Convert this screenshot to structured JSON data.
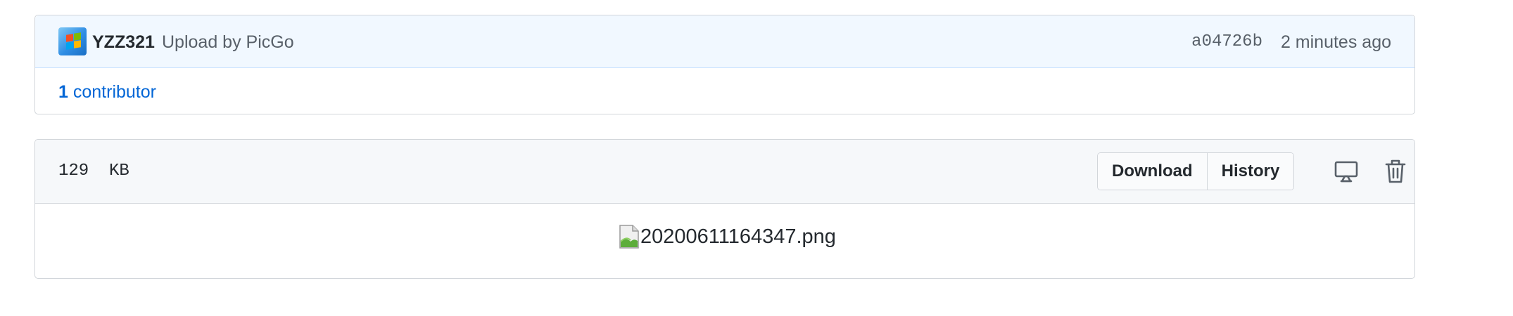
{
  "commit": {
    "author": "YZZ321",
    "message": "Upload by PicGo",
    "sha": "a04726b",
    "time": "2 minutes ago",
    "contributor_count": "1",
    "contributor_label": "contributor"
  },
  "file": {
    "size": "129  KB",
    "buttons": {
      "download": "Download",
      "history": "History"
    },
    "icons": {
      "display": "desktop-display-icon",
      "delete": "trash-icon"
    },
    "image_alt": "20200611164347.png"
  },
  "colors": {
    "link": "#0366d6",
    "commit_header_bg": "#f1f8ff",
    "file_header_bg": "#f6f8fa",
    "border": "#d1d5da",
    "muted_text": "#586069"
  }
}
